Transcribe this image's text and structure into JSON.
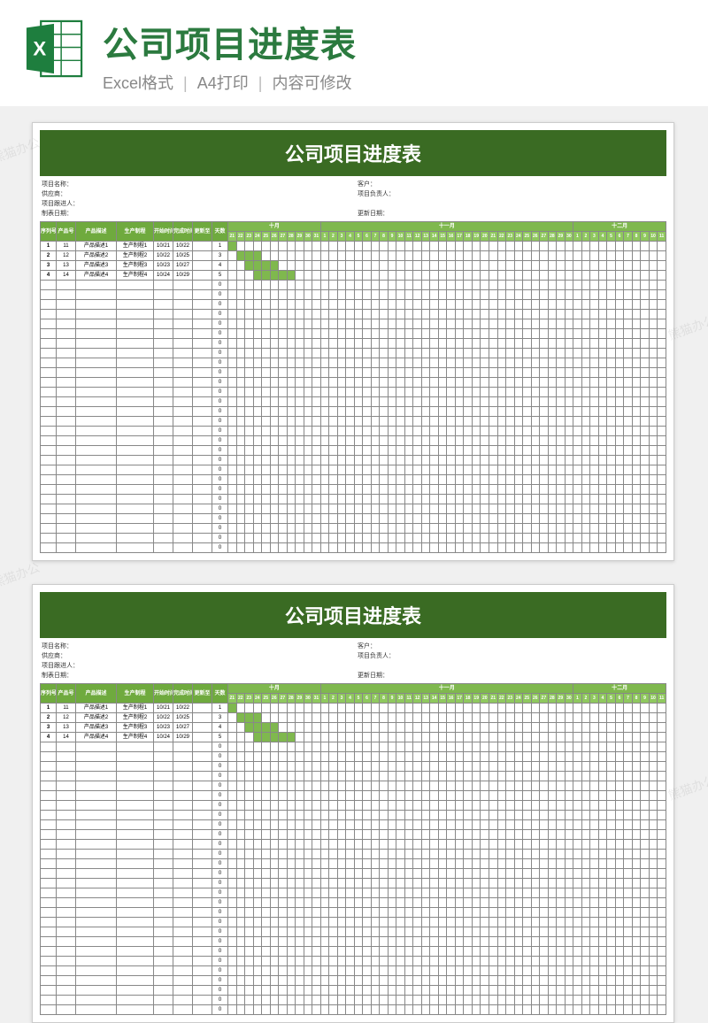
{
  "header": {
    "title": "公司项目进度表",
    "sub1": "Excel格式",
    "sub2": "A4打印",
    "sub3": "内容可修改"
  },
  "sheet": {
    "title": "公司项目进度表",
    "meta": {
      "projectName": "项目名称：",
      "customer": "客户：",
      "supplier": "供应商：",
      "projectOwner": "项目负责人：",
      "followUp": "项目跟进人：",
      "makeDate": "制表日期：",
      "updateDate": "更新日期："
    },
    "cols": {
      "seq": "序列号",
      "pn": "产品号",
      "desc": "产品描述",
      "proc": "生产制程",
      "start": "开始时间",
      "end": "完成时间",
      "update": "更新至",
      "days": "天数"
    },
    "months": [
      "十月",
      "十一月",
      "十二月"
    ],
    "rows": [
      {
        "seq": "1",
        "pn": "11",
        "desc": "产品描述1",
        "proc": "生产制程1",
        "start": "10/21",
        "end": "10/22",
        "update": "",
        "days": "1",
        "g_start": 0,
        "g_len": 1
      },
      {
        "seq": "2",
        "pn": "12",
        "desc": "产品描述2",
        "proc": "生产制程2",
        "start": "10/22",
        "end": "10/25",
        "update": "",
        "days": "3",
        "g_start": 1,
        "g_len": 3
      },
      {
        "seq": "3",
        "pn": "13",
        "desc": "产品描述3",
        "proc": "生产制程3",
        "start": "10/23",
        "end": "10/27",
        "update": "",
        "days": "4",
        "g_start": 2,
        "g_len": 4
      },
      {
        "seq": "4",
        "pn": "14",
        "desc": "产品描述4",
        "proc": "生产制程4",
        "start": "10/24",
        "end": "10/29",
        "update": "",
        "days": "5",
        "g_start": 3,
        "g_len": 5
      }
    ],
    "emptyDays": "0",
    "ganttCols": 52,
    "emptyRowCount": 28
  },
  "watermark": "熊猫办公"
}
